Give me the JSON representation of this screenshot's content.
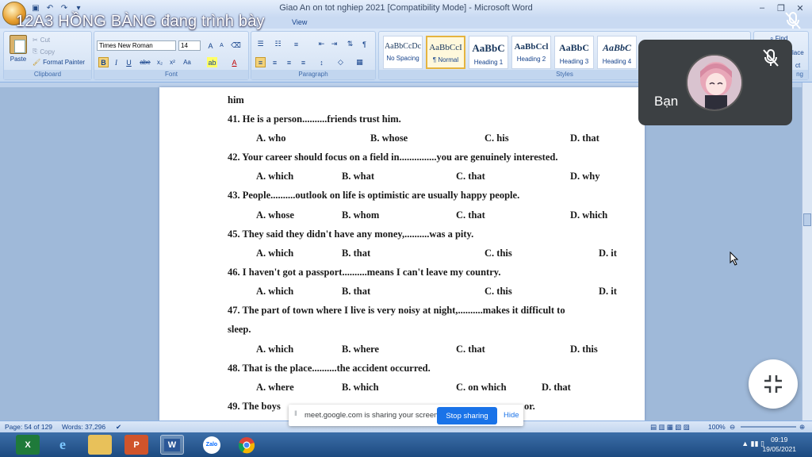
{
  "window": {
    "title": "Giao An on tot nghiep 2021 [Compatibility Mode] - Microsoft Word"
  },
  "presenter_overlay": "12A3 HỒNG BÀNG đang trình bày",
  "tabs": {
    "view": "View"
  },
  "clipboard": {
    "paste": "Paste",
    "cut": "Cut",
    "copy": "Copy",
    "format_painter": "Format Painter",
    "label": "Clipboard"
  },
  "font": {
    "name": "Times New Roman",
    "size": "14",
    "label": "Font"
  },
  "paragraph": {
    "label": "Paragraph"
  },
  "styles": {
    "label": "Styles",
    "items": [
      {
        "sample": "AaBbCcDc",
        "name": "No Spacing"
      },
      {
        "sample": "AaBbCcI",
        "name": "¶ Normal"
      },
      {
        "sample": "AaBbC",
        "name": "Heading 1"
      },
      {
        "sample": "AaBbCcl",
        "name": "Heading 2"
      },
      {
        "sample": "AaBbC",
        "name": "Heading 3"
      },
      {
        "sample": "AaBbC",
        "name": "Heading 4"
      }
    ]
  },
  "editing": {
    "find": "Find",
    "replace": "lace",
    "select": "ct",
    "label": "ng"
  },
  "document": {
    "lines": [
      "him",
      "41. He is a person..........friends trust him.",
      "42. Your career should focus on a field in...............you are genuinely interested.",
      "43. People..........outlook on life is optimistic are usually happy people.",
      "45. They said they didn't have any money,..........was a pity.",
      "46. I haven't got a passport..........means I can't leave my country.",
      "47. The part of town where I live is very noisy at night,..........makes it difficult to",
      "sleep.",
      "48. That is the place..........the accident occurred.",
      "49. The boys",
      "or."
    ],
    "options": {
      "q41": [
        "A. who",
        "B. whose",
        "C. his",
        "D. that"
      ],
      "q42": [
        "A. which",
        "B. what",
        "C. that",
        "D. why"
      ],
      "q43": [
        "A. whose",
        "B. whom",
        "C. that",
        "D. which"
      ],
      "q45": [
        "A. which",
        "B. that",
        "C. this",
        "D. it"
      ],
      "q46": [
        "A. which",
        "B. that",
        "C. this",
        "D. it"
      ],
      "q47": [
        "A. which",
        "B. where",
        "C. that",
        "D. this"
      ],
      "q48": [
        "A. where",
        "B. which",
        "C. on which",
        "D. that"
      ]
    }
  },
  "status": {
    "page": "Page: 54 of 129",
    "words": "Words: 37,296",
    "zoom": "100%"
  },
  "meet": {
    "tile_name": "Bạn",
    "share_text": "meet.google.com is sharing your screen.",
    "stop_sharing": "Stop sharing",
    "hide": "Hide"
  },
  "taskbar": {
    "apps": [
      "excel-icon",
      "ie-icon",
      "folder-icon",
      "powerpoint-icon",
      "word-icon",
      "zalo-icon",
      "chrome-icon"
    ],
    "zalo": "Zalo",
    "time": "09:19",
    "date": "19/05/2021"
  }
}
